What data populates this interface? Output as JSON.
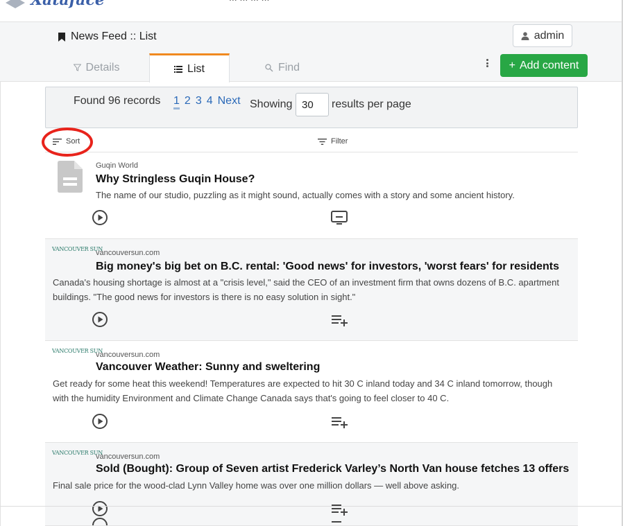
{
  "app": {
    "logo_text": "Xataface",
    "tagline": "... ... ... ...",
    "brand_color": "#3a5fa8"
  },
  "header": {
    "title": "News Feed :: List",
    "title_icon": "bookmark-icon",
    "user": {
      "label": "admin",
      "icon": "user-icon"
    }
  },
  "tabs": [
    {
      "label": "Details",
      "icon": "filter-funnel-icon",
      "active": false
    },
    {
      "label": "List",
      "icon": "list-icon",
      "active": true
    },
    {
      "label": "Find",
      "icon": "search-icon",
      "active": false
    }
  ],
  "actions": {
    "more_icon": "kebab-icon",
    "add_content": "Add content",
    "add_color": "#28a745"
  },
  "results": {
    "found_text": "Found 96 records",
    "pages": [
      "1",
      "2",
      "3",
      "4"
    ],
    "current_page": "1",
    "next": "Next",
    "showing_label": "Showing",
    "per_page_value": "30",
    "per_page_suffix": "results per page"
  },
  "toolbar": {
    "sort_label": "Sort",
    "filter_label": "Filter",
    "highlight_color": "#e8231b"
  },
  "items": [
    {
      "logo": "",
      "source": "Guqin World",
      "title": "Why Stringless Guqin House?",
      "summary": "The name of our studio, puzzling as it might sound, actually comes with a story and some ancient history.",
      "action_icon": "monitor-icon"
    },
    {
      "logo": "VANCOUVER SUN",
      "source": "vancouversun.com",
      "title": "Big money's big bet on B.C. rental: 'Good news' for investors, 'worst fears' for residents",
      "summary": "Canada's housing shortage is almost at a \"crisis level,\" said the CEO of an investment firm that owns dozens of B.C. apartment buildings. \"The good news for investors is there is no easy solution in sight.\"",
      "action_icon": "playlist-add-icon"
    },
    {
      "logo": "VANCOUVER SUN",
      "source": "vancouversun.com",
      "title": "Vancouver Weather: Sunny and sweltering",
      "summary": "Get ready for some heat this weekend! Temperatures are expected to hit 30 C inland today and 34 C inland tomorrow, though with the humidity Environment and Climate Change Canada says that's going to feel closer to 40 C.",
      "action_icon": "playlist-add-icon"
    },
    {
      "logo": "VANCOUVER SUN",
      "source": "vancouversun.com",
      "title": "Sold (Bought): Group of Seven artist Frederick Varley’s North Van house fetches 13 offers",
      "summary": "Final sale price for the wood-clad Lynn Valley home was over one million dollars — well above asking.",
      "action_icon": "playlist-add-icon"
    }
  ]
}
